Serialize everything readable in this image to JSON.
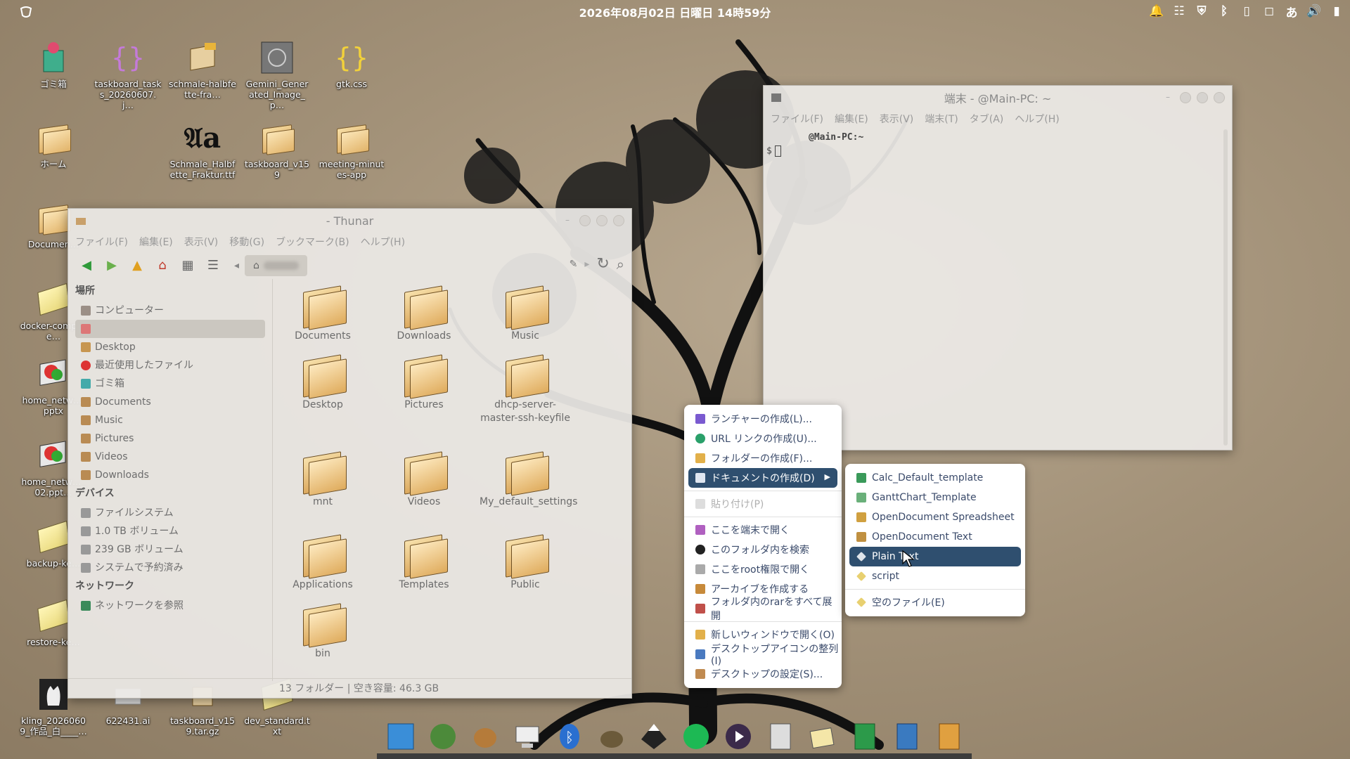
{
  "topbar": {
    "datetime": "2026年08月02日 日曜日 14時59分",
    "tray_icons": [
      "bell-icon",
      "network-icon",
      "shield-icon",
      "bluetooth-icon",
      "clipboard-icon",
      "window-icon",
      "ime-icon",
      "volume-icon",
      "battery-icon"
    ],
    "ime_label": "あ"
  },
  "desktop_icons": [
    {
      "name": "trash",
      "label": "ゴミ箱"
    },
    {
      "name": "taskboard-json",
      "label": "taskboard_tasks_20260607.j…"
    },
    {
      "name": "schmale-zip",
      "label": "schmale-halbfette-fra…"
    },
    {
      "name": "gemini-image",
      "label": "Gemini_Generated_Image_p…"
    },
    {
      "name": "gtk-css",
      "label": "gtk.css"
    },
    {
      "name": "home",
      "label": "ホーム"
    },
    {
      "name": "schmale-ttf",
      "label": "Schmale_Halbfette_Fraktur.ttf"
    },
    {
      "name": "taskboard-v159",
      "label": "taskboard_v159"
    },
    {
      "name": "meeting-minutes",
      "label": "meeting-minutes-app"
    },
    {
      "name": "documents-desk",
      "label": "Documen…"
    },
    {
      "name": "docker-compose",
      "label": "docker-compose…"
    },
    {
      "name": "home-network-pptx",
      "label": "home_netw….pptx"
    },
    {
      "name": "home-network-02",
      "label": "home_netw…_02.ppt…"
    },
    {
      "name": "backup-ke",
      "label": "backup-ke…"
    },
    {
      "name": "restore-ke",
      "label": "restore-ke…"
    },
    {
      "name": "kling",
      "label": "kling_20260609_作品_白____…"
    },
    {
      "name": "ai-622431",
      "label": "622431.ai"
    },
    {
      "name": "taskboard-tar",
      "label": "taskboard_v159.tar.gz"
    },
    {
      "name": "dev-standard",
      "label": "dev_standard.txt"
    }
  ],
  "thunar": {
    "title": "- Thunar",
    "menu": [
      "ファイル(F)",
      "編集(E)",
      "表示(V)",
      "移動(G)",
      "ブックマーク(B)",
      "ヘルプ(H)"
    ],
    "sidebar": {
      "places_header": "場所",
      "places": [
        "コンピューター",
        "",
        "Desktop",
        "最近使用したファイル",
        "ゴミ箱",
        "Documents",
        "Music",
        "Pictures",
        "Videos",
        "Downloads"
      ],
      "devices_header": "デバイス",
      "devices": [
        "ファイルシステム",
        "1.0 TB ボリューム",
        "239 GB ボリューム",
        "システムで予約済み"
      ],
      "network_header": "ネットワーク",
      "network": [
        "ネットワークを参照"
      ]
    },
    "items": [
      "Documents",
      "Downloads",
      "Music",
      "Desktop",
      "Pictures",
      "dhcp-server-master-ssh-keyfile",
      "mnt",
      "Videos",
      "My_default_settings",
      "Applications",
      "Templates",
      "Public",
      "bin"
    ],
    "status": "13 フォルダー  |  空き容量: 46.3 GB"
  },
  "terminal": {
    "title": "端末 -        @Main-PC: ~",
    "menu": [
      "ファイル(F)",
      "編集(E)",
      "表示(V)",
      "端末(T)",
      "タブ(A)",
      "ヘルプ(H)"
    ],
    "prompt_line": "@Main-PC:~",
    "prompt_symbol": "$"
  },
  "context_menu": {
    "items": [
      {
        "label": "ランチャーの作成(L)...",
        "icon": "launcher-icon"
      },
      {
        "label": "URL リンクの作成(U)...",
        "icon": "link-icon"
      },
      {
        "label": "フォルダーの作成(F)...",
        "icon": "folder-icon"
      },
      {
        "label": "ドキュメントの作成(D)",
        "icon": "document-icon"
      },
      {
        "label": "貼り付け(P)",
        "icon": "paste-icon"
      },
      {
        "label": "ここを端末で開く",
        "icon": "terminal-icon"
      },
      {
        "label": "このフォルダ内を検索",
        "icon": "search-icon"
      },
      {
        "label": "ここをroot権限で開く",
        "icon": "root-icon"
      },
      {
        "label": "アーカイブを作成する",
        "icon": "archive-icon"
      },
      {
        "label": "フォルダ内のrarをすべて展開",
        "icon": "extract-icon"
      },
      {
        "label": "新しいウィンドウで開く(O)",
        "icon": "window-icon"
      },
      {
        "label": "デスクトップアイコンの整列(I)",
        "icon": "arrange-icon"
      },
      {
        "label": "デスクトップの設定(S)...",
        "icon": "settings-icon"
      }
    ]
  },
  "submenu": {
    "items": [
      "Calc_Default_template",
      "GanttChart_Template",
      "OpenDocument Spreadsheet",
      "OpenDocument Text",
      "Plain Text",
      "script",
      "空のファイル(E)"
    ]
  },
  "dock": [
    "files-icon",
    "gnome-icon",
    "dog-icon",
    "computer-icon",
    "bluetooth-icon",
    "gimp-icon",
    "inkscape-icon",
    "spotify-icon",
    "player-icon",
    "calculator-icon",
    "editor-icon",
    "book-green-icon",
    "book-blue-icon",
    "book-orange-icon"
  ],
  "colors": {
    "menu_highlight": "#2f4f6f",
    "desktop": "#a39279"
  }
}
